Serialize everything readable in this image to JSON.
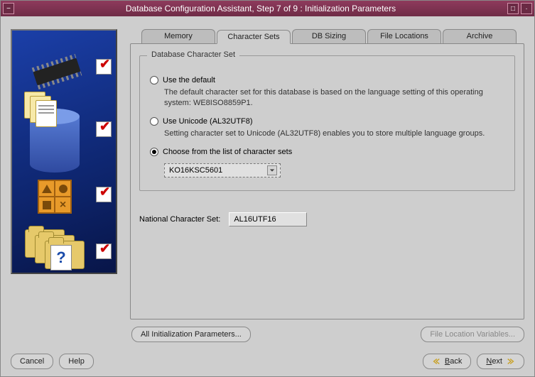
{
  "window": {
    "title": "Database Configuration Assistant, Step 7 of 9 : Initialization Parameters"
  },
  "tabs": {
    "memory": "Memory",
    "charsets": "Character Sets",
    "dbsizing": "DB Sizing",
    "filelocations": "File Locations",
    "archive": "Archive"
  },
  "fieldset": {
    "legend": "Database Character Set",
    "opt_default_label": "Use the default",
    "opt_default_desc": "The default character set for this database is based on the language setting of this operating system: WE8ISO8859P1.",
    "opt_unicode_label": "Use Unicode (AL32UTF8)",
    "opt_unicode_desc": "Setting character set to Unicode (AL32UTF8) enables you to store multiple language groups.",
    "opt_choose_label": "Choose from the list of character sets",
    "choose_select_value": "KO16KSC5601"
  },
  "national": {
    "label": "National Character Set:",
    "value": "AL16UTF16"
  },
  "buttons": {
    "all_init": "All Initialization Parameters...",
    "file_loc_vars": "File Location Variables...",
    "cancel": "Cancel",
    "help": "Help",
    "back": "Back",
    "next": "Next"
  }
}
